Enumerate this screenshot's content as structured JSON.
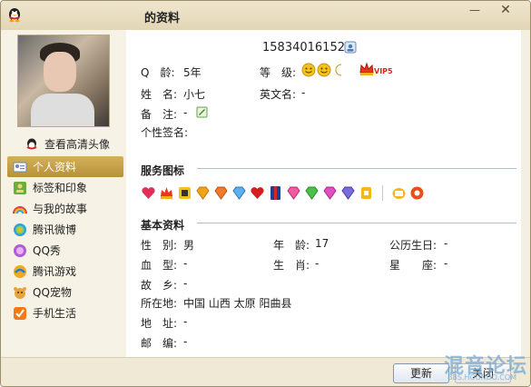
{
  "window": {
    "title": "的资料",
    "minimize_label": "—",
    "close_label": "✕"
  },
  "sidebar": {
    "hd_avatar_label": "查看高清头像",
    "items": [
      {
        "label": "个人资料",
        "icon": "profile-card-icon",
        "active": true
      },
      {
        "label": "标签和印象",
        "icon": "tag-impression-icon",
        "active": false
      },
      {
        "label": "与我的故事",
        "icon": "rainbow-story-icon",
        "active": false
      },
      {
        "label": "腾讯微博",
        "icon": "weibo-icon",
        "active": false
      },
      {
        "label": "QQ秀",
        "icon": "qq-show-icon",
        "active": false
      },
      {
        "label": "腾讯游戏",
        "icon": "tencent-games-icon",
        "active": false
      },
      {
        "label": "QQ宠物",
        "icon": "qq-pet-icon",
        "active": false
      },
      {
        "label": "手机生活",
        "icon": "mobile-life-icon",
        "active": false
      }
    ]
  },
  "profile": {
    "qq_number": "15834016152",
    "age_label": "Q　龄:",
    "age_value": "5年",
    "level_label": "等　级:",
    "vip_text": "VIP5",
    "name_label": "姓　名:",
    "name_value": "小七",
    "english_name_label": "英文名:",
    "english_name_value": "-",
    "remark_label": "备　注:",
    "remark_value": "-",
    "signature_label": "个性签名:"
  },
  "services": {
    "title": "服务图标"
  },
  "basic": {
    "title": "基本资料",
    "gender_label": "性　别:",
    "gender_value": "男",
    "age_label": "年　龄:",
    "age_value": "17",
    "birthday_label": "公历生日:",
    "birthday_value": "-",
    "blood_label": "血　型:",
    "blood_value": "-",
    "zodiac_label": "生　肖:",
    "zodiac_value": "-",
    "constellation_label": "星　　座:",
    "constellation_value": "-",
    "hometown_label": "故　乡:",
    "hometown_value": "-",
    "location_label": "所在地:",
    "location_value": "中国 山西 太原 阳曲县",
    "address_label": "地　址:",
    "address_value": "-",
    "zip_label": "邮　编:",
    "zip_value": "-"
  },
  "footer": {
    "update_label": "更新",
    "close_label": "关闭"
  },
  "watermark": {
    "text": "混音论坛",
    "sub": "BBS.HOUNDO.COM"
  },
  "colors": {
    "accent": "#b8923a",
    "section_line": "#9ec3e0"
  }
}
